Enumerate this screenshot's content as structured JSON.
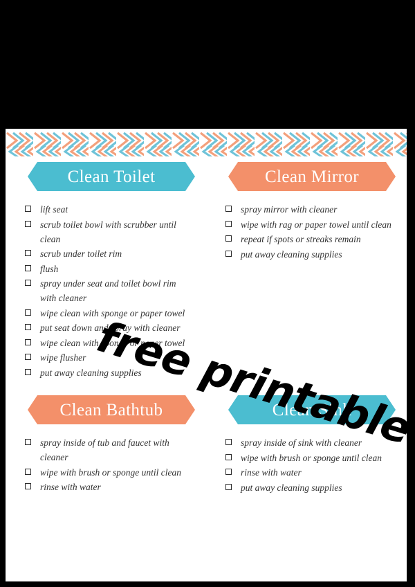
{
  "page": {
    "watermark": "free printable",
    "colors": {
      "teal": "#4BBDD0",
      "orange": "#F3906A",
      "text": "#333333",
      "paper": "#FFFFFF",
      "letterbox": "#000000"
    },
    "border_pattern": "chevron-stripe-border"
  },
  "sections": [
    {
      "id": "clean-toilet",
      "title": "Clean Toilet",
      "color": "teal",
      "items": [
        "lift seat",
        "scrub toilet bowl with scrubber until clean",
        "scrub under toilet rim",
        "flush",
        "spray under seat and toilet bowl rim with cleaner",
        "wipe clean with sponge or paper towel",
        "put seat down and spray with cleaner",
        "wipe clean with sponge or paper towel",
        "wipe flusher",
        "put away cleaning supplies"
      ]
    },
    {
      "id": "clean-mirror",
      "title": "Clean Mirror",
      "color": "orange",
      "items": [
        "spray mirror with cleaner",
        "wipe with rag or paper towel until clean",
        "repeat if spots or streaks remain",
        "put away cleaning supplies"
      ]
    },
    {
      "id": "clean-bathtub",
      "title": "Clean Bathtub",
      "color": "orange",
      "items": [
        "spray inside of tub and faucet with cleaner",
        "wipe with brush or sponge until clean",
        "rinse with water"
      ]
    },
    {
      "id": "clean-sink",
      "title": "Clean Sink",
      "color": "teal",
      "items": [
        "spray inside of sink with cleaner",
        "wipe with brush or sponge until clean",
        "rinse with water",
        "put away cleaning supplies"
      ]
    }
  ]
}
